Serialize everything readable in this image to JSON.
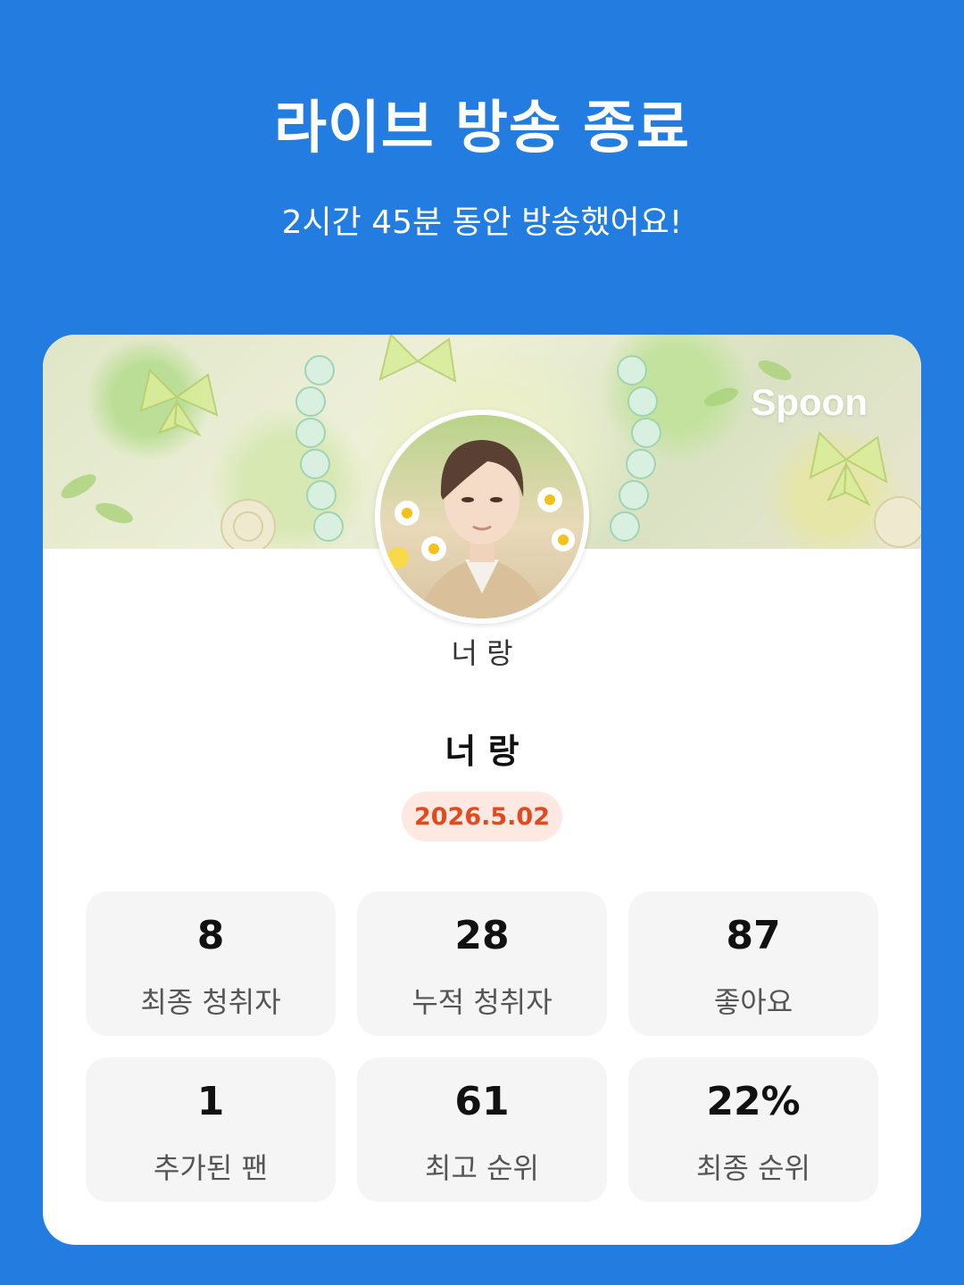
{
  "header": {
    "title": "라이브 방송 종료",
    "subtitle": "2시간 45분 동안 방송했어요!"
  },
  "card": {
    "brand": "Spoon",
    "nickname": "너 랑",
    "live_title": "너 랑",
    "date": "2026.5.02",
    "stats": [
      {
        "value": "8",
        "label": "최종 청취자"
      },
      {
        "value": "28",
        "label": "누적 청취자"
      },
      {
        "value": "87",
        "label": "좋아요"
      },
      {
        "value": "1",
        "label": "추가된 팬"
      },
      {
        "value": "61",
        "label": "최고 순위"
      },
      {
        "value": "22%",
        "label": "최종 순위"
      }
    ]
  },
  "colors": {
    "background": "#237de0",
    "date_text": "#e04a1f",
    "date_bg": "#fde8e2",
    "stat_bg": "#f5f5f5"
  }
}
